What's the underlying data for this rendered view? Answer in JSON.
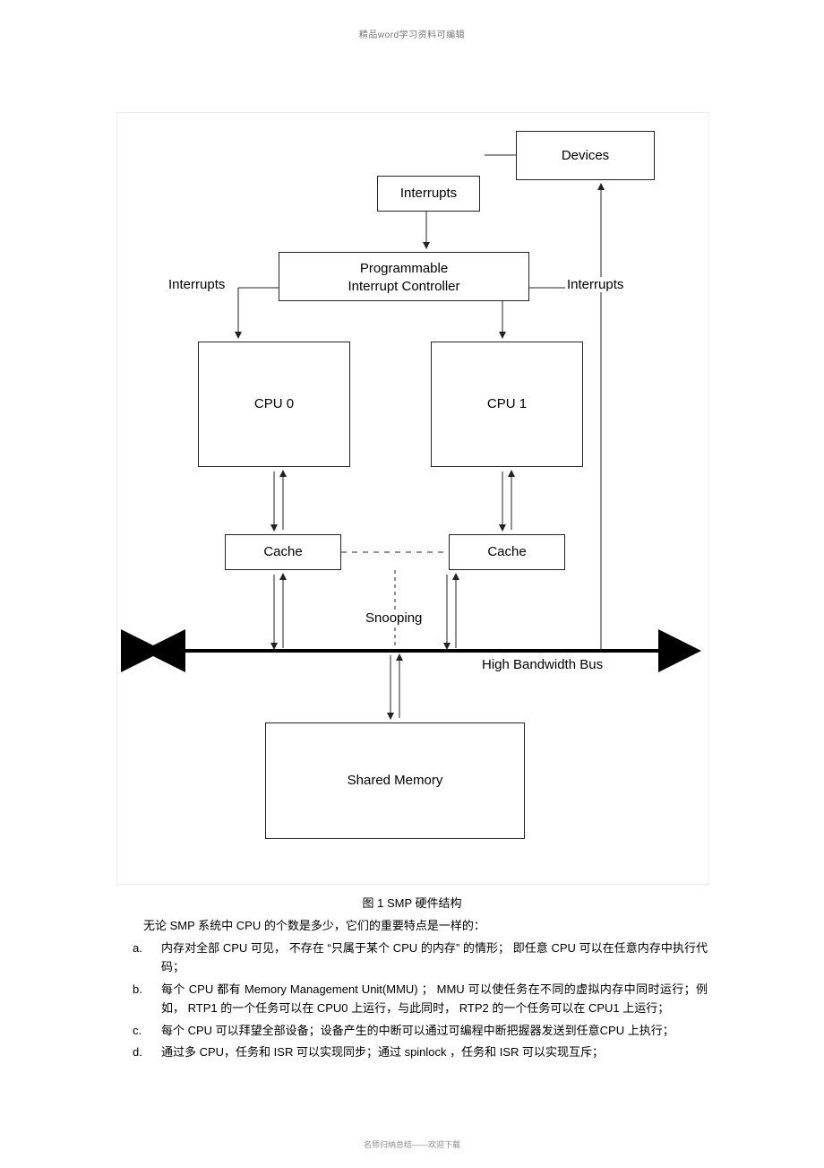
{
  "header_watermark": "精品word学习资料可编辑",
  "footer_watermark": "名师归纳总结——欢迎下载",
  "diagram": {
    "devices": "Devices",
    "interrupts_box": "Interrupts",
    "pic_line1": "Programmable",
    "pic_line2": "Interrupt Controller",
    "interrupts_left": "Interrupts",
    "interrupts_right": "Interrupts",
    "cpu0": "CPU 0",
    "cpu1": "CPU 1",
    "cache0": "Cache",
    "cache1": "Cache",
    "snooping": "Snooping",
    "bus_label": "High Bandwidth Bus",
    "shared_memory": "Shared Memory"
  },
  "caption": "图  1 SMP 硬件结构",
  "intro": "无论  SMP 系统中  CPU  的个数是多少，它们的重要特点是一样的：",
  "items": [
    "内存对全部  CPU  可见，  不存在  “只属于某个  CPU  的内存”  的情形；  即任意  CPU  可以在任意内存中执行代码；",
    "每个  CPU  都有  Memory  Management  Unit(MMU)  ；  MMU  可以使任务在不同的虚拟内存中同时运行；例如，      RTP1  的一个任务可以在    CPU0 上运行，与此同时，  RTP2  的一个任务可以在  CPU1  上运行；",
    "每个  CPU  可以拜望全部设备；设备产生的中断可以通过可编程中断把握器发送到任意CPU  上执行；",
    "通过多  CPU，任务和    ISR 可以实现同步；通过    spinlock  ，任务和    ISR  可以实现互斥；"
  ]
}
